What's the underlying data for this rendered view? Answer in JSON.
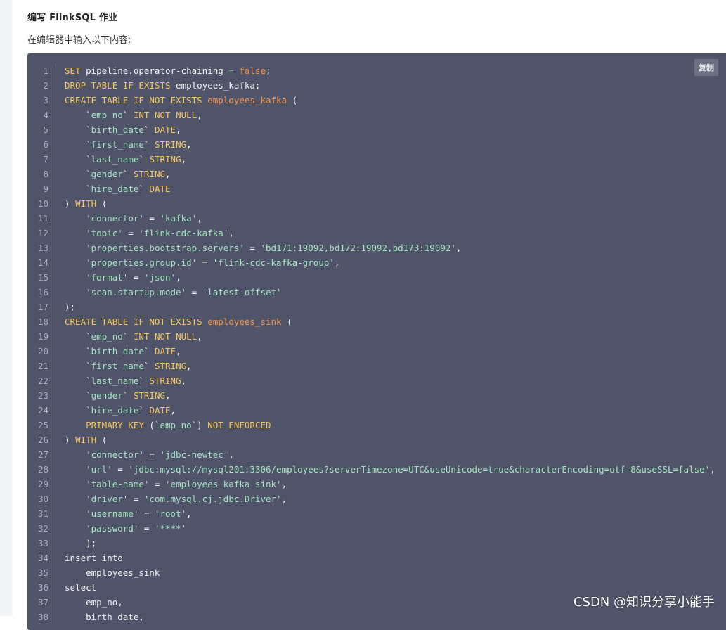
{
  "header": {
    "title": "编写 FlinkSQL 作业",
    "description": "在编辑器中输入以下内容:"
  },
  "code_block": {
    "copy_label": "复制",
    "lines": [
      [
        [
          "kw",
          "SET"
        ],
        [
          "txt",
          " pipeline.operator-chaining "
        ],
        [
          "str",
          "="
        ],
        [
          "txt",
          " "
        ],
        [
          "tbl",
          "false"
        ],
        [
          "txt",
          ";"
        ]
      ],
      [
        [
          "kw",
          "DROP TABLE IF EXISTS"
        ],
        [
          "txt",
          " employees_kafka;"
        ]
      ],
      [
        [
          "kw",
          "CREATE TABLE IF NOT EXISTS"
        ],
        [
          "txt",
          " "
        ],
        [
          "tbl",
          "employees_kafka"
        ],
        [
          "txt",
          " ("
        ]
      ],
      [
        [
          "txt",
          "    `"
        ],
        [
          "str",
          "emp_no"
        ],
        [
          "txt",
          "` "
        ],
        [
          "kw",
          "INT NOT NULL"
        ],
        [
          "txt",
          ","
        ]
      ],
      [
        [
          "txt",
          "    `"
        ],
        [
          "str",
          "birth_date"
        ],
        [
          "txt",
          "` "
        ],
        [
          "kw",
          "DATE"
        ],
        [
          "txt",
          ","
        ]
      ],
      [
        [
          "txt",
          "    `"
        ],
        [
          "str",
          "first_name"
        ],
        [
          "txt",
          "` "
        ],
        [
          "kw",
          "STRING"
        ],
        [
          "txt",
          ","
        ]
      ],
      [
        [
          "txt",
          "    `"
        ],
        [
          "str",
          "last_name"
        ],
        [
          "txt",
          "` "
        ],
        [
          "kw",
          "STRING"
        ],
        [
          "txt",
          ","
        ]
      ],
      [
        [
          "txt",
          "    `"
        ],
        [
          "str",
          "gender"
        ],
        [
          "txt",
          "` "
        ],
        [
          "kw",
          "STRING"
        ],
        [
          "txt",
          ","
        ]
      ],
      [
        [
          "txt",
          "    `"
        ],
        [
          "str",
          "hire_date"
        ],
        [
          "txt",
          "` "
        ],
        [
          "kw",
          "DATE"
        ]
      ],
      [
        [
          "txt",
          ") "
        ],
        [
          "kw",
          "WITH"
        ],
        [
          "txt",
          " ("
        ]
      ],
      [
        [
          "txt",
          "    "
        ],
        [
          "str",
          "'connector'"
        ],
        [
          "txt",
          " = "
        ],
        [
          "str",
          "'kafka'"
        ],
        [
          "txt",
          ","
        ]
      ],
      [
        [
          "txt",
          "    "
        ],
        [
          "str",
          "'topic'"
        ],
        [
          "txt",
          " = "
        ],
        [
          "str",
          "'flink-cdc-kafka'"
        ],
        [
          "txt",
          ","
        ]
      ],
      [
        [
          "txt",
          "    "
        ],
        [
          "str",
          "'properties.bootstrap.servers'"
        ],
        [
          "txt",
          " = "
        ],
        [
          "str",
          "'bd171:19092,bd172:19092,bd173:19092'"
        ],
        [
          "txt",
          ","
        ]
      ],
      [
        [
          "txt",
          "    "
        ],
        [
          "str",
          "'properties.group.id'"
        ],
        [
          "txt",
          " = "
        ],
        [
          "str",
          "'flink-cdc-kafka-group'"
        ],
        [
          "txt",
          ","
        ]
      ],
      [
        [
          "txt",
          "    "
        ],
        [
          "str",
          "'format'"
        ],
        [
          "txt",
          " = "
        ],
        [
          "str",
          "'json'"
        ],
        [
          "txt",
          ","
        ]
      ],
      [
        [
          "txt",
          "    "
        ],
        [
          "str",
          "'scan.startup.mode'"
        ],
        [
          "txt",
          " = "
        ],
        [
          "str",
          "'latest-offset'"
        ]
      ],
      [
        [
          "txt",
          ");"
        ]
      ],
      [
        [
          "kw",
          "CREATE TABLE IF NOT EXISTS"
        ],
        [
          "txt",
          " "
        ],
        [
          "tbl",
          "employees_sink"
        ],
        [
          "txt",
          " ("
        ]
      ],
      [
        [
          "txt",
          "    `"
        ],
        [
          "str",
          "emp_no"
        ],
        [
          "txt",
          "` "
        ],
        [
          "kw",
          "INT NOT NULL"
        ],
        [
          "txt",
          ","
        ]
      ],
      [
        [
          "txt",
          "    `"
        ],
        [
          "str",
          "birth_date"
        ],
        [
          "txt",
          "` "
        ],
        [
          "kw",
          "DATE"
        ],
        [
          "txt",
          ","
        ]
      ],
      [
        [
          "txt",
          "    `"
        ],
        [
          "str",
          "first_name"
        ],
        [
          "txt",
          "` "
        ],
        [
          "kw",
          "STRING"
        ],
        [
          "txt",
          ","
        ]
      ],
      [
        [
          "txt",
          "    `"
        ],
        [
          "str",
          "last_name"
        ],
        [
          "txt",
          "` "
        ],
        [
          "kw",
          "STRING"
        ],
        [
          "txt",
          ","
        ]
      ],
      [
        [
          "txt",
          "    `"
        ],
        [
          "str",
          "gender"
        ],
        [
          "txt",
          "` "
        ],
        [
          "kw",
          "STRING"
        ],
        [
          "txt",
          ","
        ]
      ],
      [
        [
          "txt",
          "    `"
        ],
        [
          "str",
          "hire_date"
        ],
        [
          "txt",
          "` "
        ],
        [
          "kw",
          "DATE"
        ],
        [
          "txt",
          ","
        ]
      ],
      [
        [
          "txt",
          "    "
        ],
        [
          "kw",
          "PRIMARY KEY"
        ],
        [
          "txt",
          " (`"
        ],
        [
          "str",
          "emp_no"
        ],
        [
          "txt",
          "`) "
        ],
        [
          "kw",
          "NOT ENFORCED"
        ]
      ],
      [
        [
          "txt",
          ") "
        ],
        [
          "kw",
          "WITH"
        ],
        [
          "txt",
          " ("
        ]
      ],
      [
        [
          "txt",
          "    "
        ],
        [
          "str",
          "'connector'"
        ],
        [
          "txt",
          " = "
        ],
        [
          "str",
          "'jdbc-newtec'"
        ],
        [
          "txt",
          ","
        ]
      ],
      [
        [
          "txt",
          "    "
        ],
        [
          "str",
          "'url'"
        ],
        [
          "txt",
          " = "
        ],
        [
          "str",
          "'jdbc:mysql://mysql201:3306/employees?serverTimezone=UTC&useUnicode=true&characterEncoding=utf-8&useSSL=false'"
        ],
        [
          "txt",
          ","
        ]
      ],
      [
        [
          "txt",
          "    "
        ],
        [
          "str",
          "'table-name'"
        ],
        [
          "txt",
          " = "
        ],
        [
          "str",
          "'employees_kafka_sink'"
        ],
        [
          "txt",
          ","
        ]
      ],
      [
        [
          "txt",
          "    "
        ],
        [
          "str",
          "'driver'"
        ],
        [
          "txt",
          " = "
        ],
        [
          "str",
          "'com.mysql.cj.jdbc.Driver'"
        ],
        [
          "txt",
          ","
        ]
      ],
      [
        [
          "txt",
          "    "
        ],
        [
          "str",
          "'username'"
        ],
        [
          "txt",
          " = "
        ],
        [
          "str",
          "'root'"
        ],
        [
          "txt",
          ","
        ]
      ],
      [
        [
          "txt",
          "    "
        ],
        [
          "str",
          "'password'"
        ],
        [
          "txt",
          " = "
        ],
        [
          "str",
          "'****'"
        ]
      ],
      [
        [
          "txt",
          "    );"
        ]
      ],
      [
        [
          "txt",
          "insert into"
        ]
      ],
      [
        [
          "txt",
          "    employees_sink"
        ]
      ],
      [
        [
          "txt",
          "select"
        ]
      ],
      [
        [
          "txt",
          "    emp_no,"
        ]
      ],
      [
        [
          "txt",
          "    birth_date,"
        ]
      ]
    ]
  },
  "watermark": "CSDN @知识分享小能手"
}
